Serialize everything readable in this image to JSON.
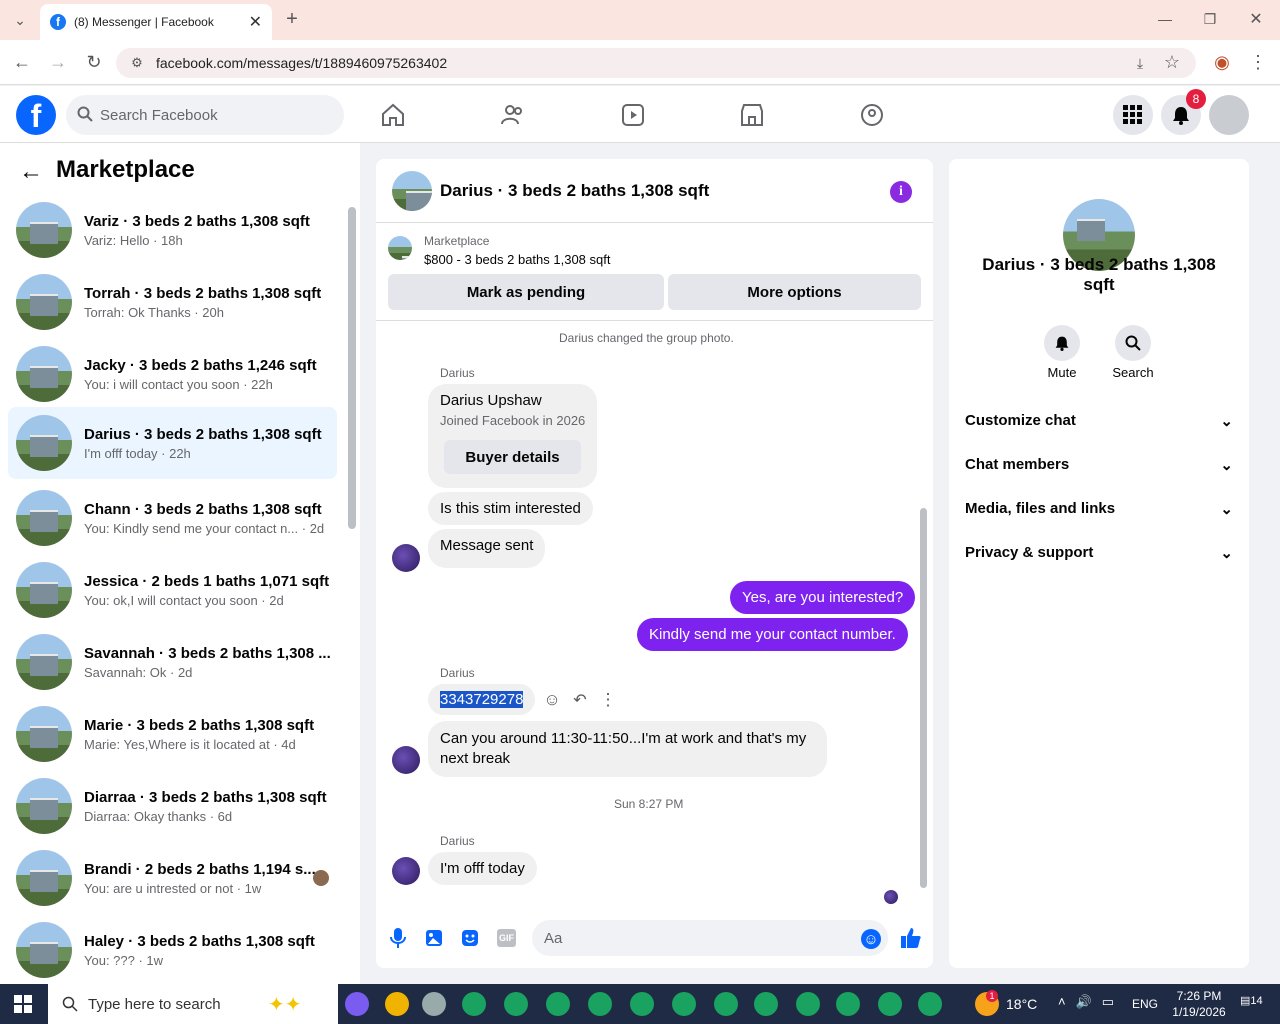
{
  "browser": {
    "tab_title": "(8) Messenger | Facebook",
    "url": "facebook.com/messages/t/1889460975263402"
  },
  "fb": {
    "search_placeholder": "Search Facebook",
    "notif_count": "8"
  },
  "left": {
    "title": "Marketplace",
    "conversations": [
      {
        "name": "Variz · 3 beds 2 baths 1,308 sqft",
        "sub": "Variz: Hello · 18h"
      },
      {
        "name": "Torrah · 3 beds 2 baths 1,308 sqft",
        "sub": "Torrah: Ok Thanks · 20h"
      },
      {
        "name": "Jacky · 3 beds 2 baths 1,246 sqft",
        "sub": "You: i will contact you soon · 22h"
      },
      {
        "name": "Darius · 3 beds 2 baths 1,308 sqft",
        "sub": "I'm offf today · 22h"
      },
      {
        "name": "Chann · 3 beds 2 baths 1,308 sqft",
        "sub": "You: Kindly send me your contact n... · 2d"
      },
      {
        "name": "Jessica · 2 beds 1 baths 1,071 sqft",
        "sub": "You: ok,I will contact you soon · 2d"
      },
      {
        "name": "Savannah · 3 beds 2 baths 1,308 ...",
        "sub": "Savannah: Ok · 2d"
      },
      {
        "name": "Marie · 3 beds 2 baths 1,308 sqft",
        "sub": "Marie: Yes,Where is it located at · 4d"
      },
      {
        "name": "Diarraa · 3 beds 2 baths 1,308 sqft",
        "sub": "Diarraa: Okay thanks · 6d"
      },
      {
        "name": "Brandi · 2 beds 2 baths 1,194 s...",
        "sub": "You: are u intrested or not · 1w"
      },
      {
        "name": "Haley · 3 beds 2 baths 1,308 sqft",
        "sub": "You: ??? · 1w"
      }
    ]
  },
  "chat": {
    "title": "Darius · 3 beds 2 baths 1,308 sqft",
    "mp_label": "Marketplace",
    "mp_listing": "$800 - 3 beds 2 baths 1,308 sqft",
    "mark_pending": "Mark as pending",
    "more_options": "More options",
    "system_msg": "Darius changed the group photo.",
    "sender": "Darius",
    "card_name": "Darius Upshaw",
    "card_sub": "Joined Facebook in 2026",
    "buyer_details": "Buyer details",
    "m1": "Is this stim interested",
    "m2": "Message sent",
    "m3": "Yes, are you interested?",
    "m4": "Kindly send me your contact number.",
    "m5": "3343729278",
    "m6a": "Can you around 11:30-11:50...I'm at work and that's my",
    "m6b": "next break",
    "time_sep": "Sun 8:27 PM",
    "m7": "I'm offf today",
    "input_placeholder": "Aa"
  },
  "info": {
    "name_l1": "Darius · 3 beds 2 baths 1,308",
    "name_l2": "sqft",
    "mute": "Mute",
    "search": "Search",
    "sections": [
      "Customize chat",
      "Chat members",
      "Media, files and links",
      "Privacy & support"
    ]
  },
  "taskbar": {
    "search": "Type here to search",
    "temp": "18°C",
    "lang": "ENG",
    "time": "7:26 PM",
    "date": "1/19/2026",
    "notif": "14",
    "weather_badge": "1"
  }
}
